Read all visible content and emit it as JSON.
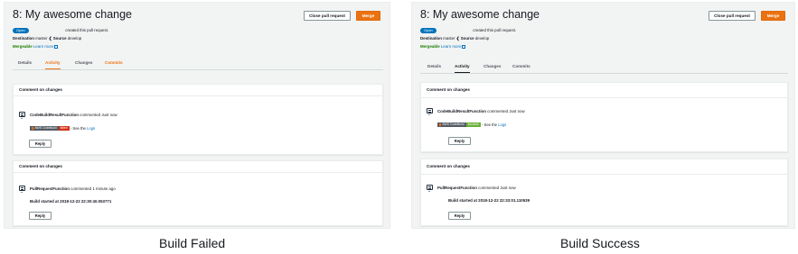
{
  "panels": [
    {
      "title": "8: My awesome change",
      "close_button": "Close pull request",
      "merge_button": "Merge",
      "status_badge": "Open",
      "created_text": "created this pull request.",
      "destination_label": "Destination",
      "destination_value": "master",
      "arrow_glyph": "❮",
      "source_label": "Source",
      "source_value": "develop",
      "mergeable": "Mergeable",
      "learn_more": "Learn more",
      "tabs": [
        "Details",
        "Activity",
        "Changes",
        "Commits"
      ],
      "cards": [
        {
          "header": "Comment on changes",
          "author": "CodeBuildResultFunction",
          "action": "commented",
          "time": "Just now",
          "build_pill": "AWS CodeBuild",
          "result_pill": "failed",
          "see_text": "- See the",
          "logs_link": "Logs",
          "reply": "Reply"
        },
        {
          "header": "Comment on changes",
          "author": "PullRequestFunction",
          "action": "commented",
          "time": "1 minute ago",
          "body": "Build started at 2018-12-22 22:30:40.053771",
          "reply": "Reply"
        }
      ]
    },
    {
      "title": "8: My awesome change",
      "close_button": "Close pull request",
      "merge_button": "Merge",
      "status_badge": "Open",
      "created_text": "created this pull request.",
      "destination_label": "Destination",
      "destination_value": "master",
      "arrow_glyph": "❮",
      "source_label": "Source",
      "source_value": "develop",
      "mergeable": "Mergeable",
      "learn_more": "Learn more",
      "tabs": [
        "Details",
        "Activity",
        "Changes",
        "Commits"
      ],
      "cards": [
        {
          "header": "Comment on changes",
          "author": "CodeBuildResultFunction",
          "action": "commented",
          "time": "Just now",
          "build_pill": "AWS CodeBuild",
          "result_pill": "success",
          "see_text": "- See the",
          "logs_link": "Logs",
          "reply": "Reply"
        },
        {
          "header": "Comment on changes",
          "author": "PullRequestFunction",
          "action": "commented",
          "time": "Just now",
          "body": "Build started at 2018-12-22 22:33:01.110539",
          "reply": "Reply"
        }
      ]
    }
  ],
  "captions": [
    "Build Failed",
    "Build Success"
  ],
  "colors": {
    "accent_orange": "#ec7211",
    "link_blue": "#0073bb",
    "mergeable_green": "#1d8102",
    "failed_red": "#d13212",
    "success_green": "#6aaf35"
  },
  "icons": {
    "comment": "comment-icon",
    "external_link": "external-link-icon"
  }
}
